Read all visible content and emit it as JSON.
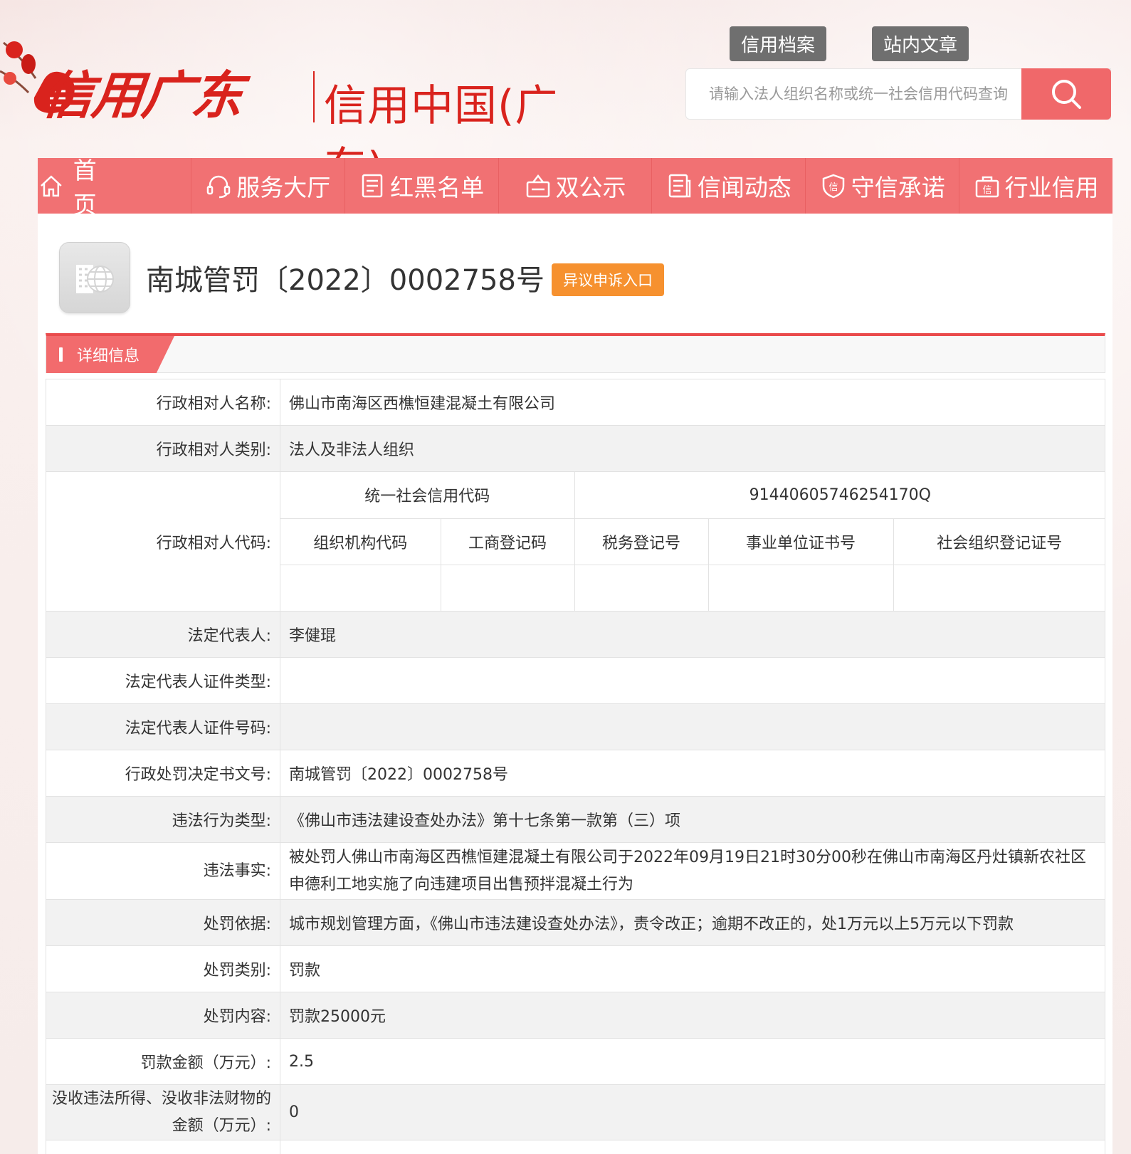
{
  "header": {
    "logo_script": "信用广东",
    "logo_title": "信用中国(广东)",
    "top_tabs": [
      "信用档案",
      "站内文章"
    ],
    "search_placeholder": "请输入法人组织名称或统一社会信用代码查询"
  },
  "nav": {
    "items": [
      {
        "label": "首页",
        "icon": "home-icon"
      },
      {
        "label": "服务大厅",
        "icon": "headset-icon"
      },
      {
        "label": "红黑名单",
        "icon": "list-icon"
      },
      {
        "label": "双公示",
        "icon": "announcement-icon"
      },
      {
        "label": "信闻动态",
        "icon": "news-icon"
      },
      {
        "label": "守信承诺",
        "icon": "shield-icon"
      },
      {
        "label": "行业信用",
        "icon": "industry-icon"
      }
    ]
  },
  "record": {
    "title": "南城管罚〔2022〕0002758号",
    "appeal_label": "异议申诉入口"
  },
  "section": {
    "title": "详细信息"
  },
  "details": {
    "name_label": "行政相对人名称:",
    "name_value": "佛山市南海区西樵恒建混凝土有限公司",
    "type_label": "行政相对人类别:",
    "type_value": "法人及非法人组织",
    "code_label": "行政相对人代码:",
    "codes": {
      "uscc_label": "统一社会信用代码",
      "uscc_value": "91440605746254170Q",
      "headers": [
        "组织机构代码",
        "工商登记码",
        "税务登记号",
        "事业单位证书号",
        "社会组织登记证号"
      ],
      "values": [
        "",
        "",
        "",
        "",
        ""
      ]
    },
    "rep_label": "法定代表人:",
    "rep_value": "李健琨",
    "rep_id_type_label": "法定代表人证件类型:",
    "rep_id_type_value": "",
    "rep_id_no_label": "法定代表人证件号码:",
    "rep_id_no_value": "",
    "doc_no_label": "行政处罚决定书文号:",
    "doc_no_value": "南城管罚〔2022〕0002758号",
    "violation_type_label": "违法行为类型:",
    "violation_type_value": "《佛山市违法建设查处办法》第十七条第一款第（三）项",
    "facts_label": "违法事实:",
    "facts_value": "被处罚人佛山市南海区西樵恒建混凝土有限公司于2022年09月19日21时30分00秒在佛山市南海区丹灶镇新农社区申德利工地实施了向违建项目出售预拌混凝土行为",
    "basis_label": "处罚依据:",
    "basis_value": "城市规划管理方面，《佛山市违法建设查处办法》，责令改正；逾期不改正的，处1万元以上5万元以下罚款",
    "category_label": "处罚类别:",
    "category_value": "罚款",
    "content_label": "处罚内容:",
    "content_value": "罚款25000元",
    "amount_label": "罚款金额（万元）:",
    "amount_value": "2.5",
    "confiscation_label": "没收违法所得、没收非法财物的金额（万元）:",
    "confiscation_value": "0"
  },
  "colors": {
    "nav_bg": "#f17173",
    "brand_red": "#d9231d",
    "appeal_orange": "#f6912f",
    "tab_gray": "#6f6f6f"
  }
}
